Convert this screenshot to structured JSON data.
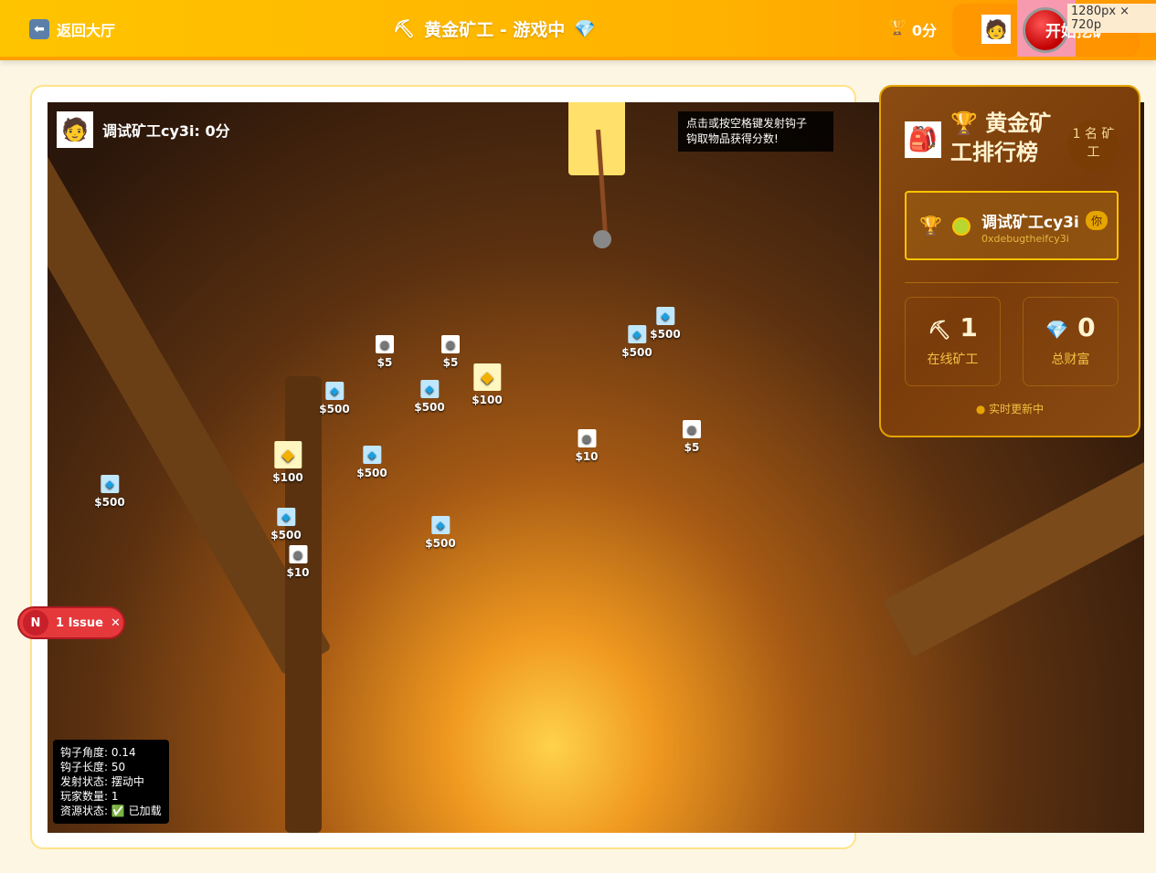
{
  "topbar": {
    "back_label": "返回大厅",
    "title": "黄金矿工 - 游戏中",
    "score": "0分",
    "start_label": "开始挖矿",
    "resolution": "1280px × 720p"
  },
  "game": {
    "player_label": "调试矿工cy3i: 0分",
    "hint": [
      "点击或按空格键发射钩子",
      "钩取物品获得分数!"
    ],
    "items": [
      {
        "type": "rock",
        "value": "$5"
      },
      {
        "type": "rock",
        "value": "$5"
      },
      {
        "type": "diamond",
        "value": "$500"
      },
      {
        "type": "diamond",
        "value": "$500"
      },
      {
        "type": "diamond",
        "value": "$500"
      },
      {
        "type": "diamond",
        "value": "$500"
      },
      {
        "type": "gold",
        "value": "$100"
      },
      {
        "type": "rock",
        "value": "$10"
      },
      {
        "type": "rock",
        "value": "$5"
      },
      {
        "type": "gold",
        "value": "$100"
      },
      {
        "type": "diamond",
        "value": "$500"
      },
      {
        "type": "diamond",
        "value": "$500"
      },
      {
        "type": "diamond",
        "value": "$500"
      },
      {
        "type": "rock",
        "value": "$10"
      },
      {
        "type": "diamond",
        "value": "$500"
      }
    ],
    "debug": [
      "钩子角度: 0.14",
      "钩子长度: 50",
      "发射状态: 摆动中",
      "玩家数量: 1",
      "资源状态: ✅ 已加载"
    ]
  },
  "issue": {
    "label": "1 Issue"
  },
  "leaderboard": {
    "title": "🏆 黄金矿工排行榜",
    "count": "1 名 矿工",
    "player_name": "调试矿工cy3i",
    "you_badge": "你",
    "address": "0xdebugtheifcy3i",
    "online_value": "1",
    "online_label": "在线矿工",
    "wealth_value": "0",
    "wealth_label": "总财富",
    "live": "实时更新中"
  }
}
